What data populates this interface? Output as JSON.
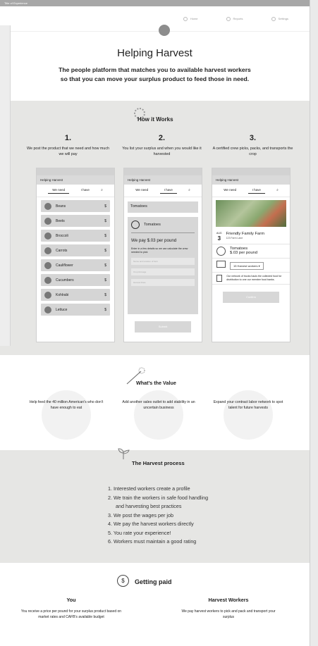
{
  "window": {
    "title": "Title of Experience"
  },
  "nav": {
    "items": [
      {
        "label": "Home",
        "icon": "home-icon"
      },
      {
        "label": "Reports",
        "icon": "report-icon"
      },
      {
        "label": "Settings",
        "icon": "gear-icon"
      }
    ]
  },
  "hero": {
    "title": "Helping Harvest",
    "subtitle_line1": "The people platform that matches you to available harvest workers",
    "subtitle_line2": "so that you can move your surplus product to feed those in need."
  },
  "how_it_works": {
    "title": "How it Works",
    "steps": [
      {
        "num": "1.",
        "desc": "We post the product that we need and how much we will pay"
      },
      {
        "num": "2.",
        "desc": "You list your surplus and when you would like it harvested"
      },
      {
        "num": "3.",
        "desc": "A certified crew picks, packs, and transports the crop"
      }
    ],
    "phone1": {
      "app": "Helping Harvest",
      "tab_need": "We need",
      "tab_have": "I have",
      "items": [
        {
          "name": "Beans",
          "price": "$"
        },
        {
          "name": "Beets",
          "price": "$"
        },
        {
          "name": "Broccoli",
          "price": "$"
        },
        {
          "name": "Carrots",
          "price": "$"
        },
        {
          "name": "Cauliflower",
          "price": "$"
        },
        {
          "name": "Cucumbers",
          "price": "$"
        },
        {
          "name": "Kohlrabi",
          "price": "$"
        },
        {
          "name": "Lettuce",
          "price": "$"
        }
      ]
    },
    "phone2": {
      "app": "Helping Harvest",
      "tab_need": "We need",
      "tab_have": "I have",
      "selected": "Tomatoes",
      "card_title": "Tomatoes",
      "pay": "We pay $.03 per pound",
      "note": "Enter in a few details so we can calculate the crew needed to pick",
      "field1": "Name and location of farm",
      "field2": "Crop Acreage",
      "field3": "Harvest Date",
      "submit": "Submit"
    },
    "phone3": {
      "app": "Helping Harvest",
      "tab_need": "We need",
      "tab_have": "I have",
      "month": "AUG",
      "day": "3",
      "farm": "Friendly Family Farm",
      "address": "123 Farm Lane",
      "crop": "Tomatoes",
      "crop_price": "$.03 per pound",
      "workers": "15 Harvest workers",
      "truck_note": "Our network of trucks hauls the collected food for distribution to one our member food banks.",
      "button": "Confirm"
    }
  },
  "value": {
    "title": "What's the Value",
    "items": [
      "Help feed the 40 million American's who don't have enough to eat",
      "Add another sales outlet to add stability in an uncertain business",
      "Expand your contract labor network to spot talent for future harvests"
    ]
  },
  "process": {
    "title": "The Harvest process",
    "steps": [
      "1. Interested workers create a profile",
      "2. We train the workers in safe food handling",
      "    and harvesting best practices",
      "3. We post the wages per job",
      "4. We pay the harvest workers directly",
      "5. You rate your experience!",
      "6. Workers must maintain a good rating"
    ]
  },
  "paid": {
    "title": "Getting paid",
    "you_title": "You",
    "you_text": "You receive a price per pound for your surplus product based on market rates and CAFB's available budget",
    "workers_title": "Harvest Workers",
    "workers_text": "We pay harvest workers to pick and pack and transport your surplus"
  }
}
